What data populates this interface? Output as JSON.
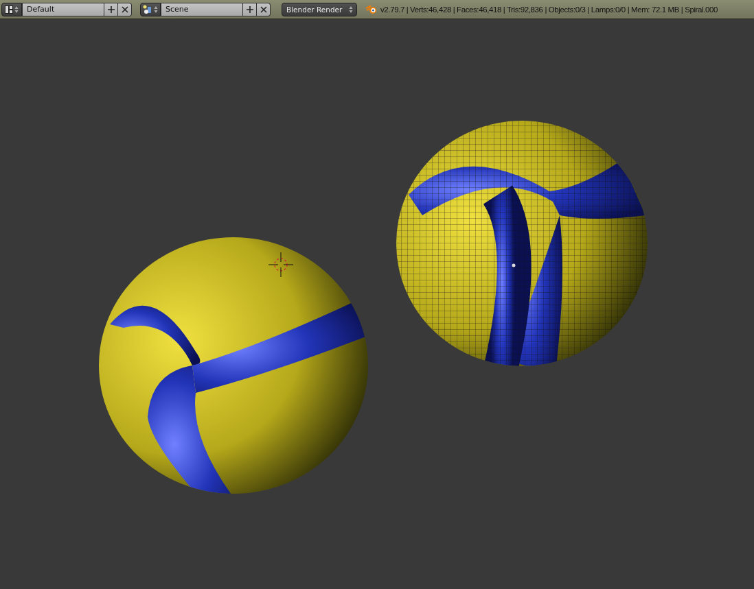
{
  "header": {
    "layout": {
      "name": "Default"
    },
    "scene": {
      "name": "Scene"
    },
    "render_engine": {
      "value": "Blender Render"
    },
    "stats": "v2.79.7 | Verts:46,428 | Faces:46,418 | Tris:92,836 | Objects:0/3 | Lamps:0/0 | Mem: 72.1 MB | Spiral.000"
  }
}
